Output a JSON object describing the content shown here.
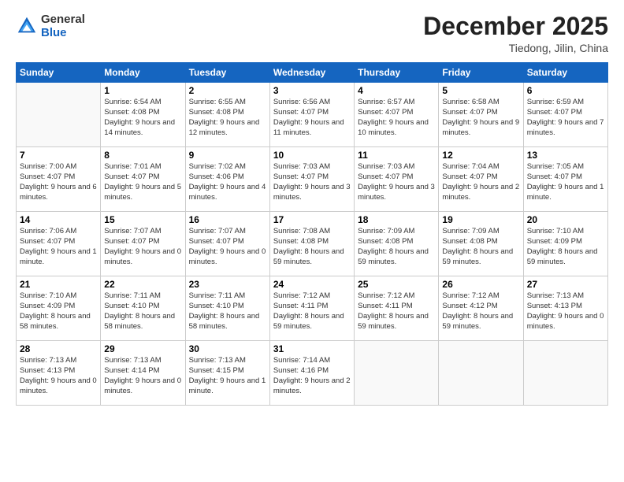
{
  "header": {
    "logo": {
      "general": "General",
      "blue": "Blue"
    },
    "title": "December 2025",
    "location": "Tiedong, Jilin, China"
  },
  "weekdays": [
    "Sunday",
    "Monday",
    "Tuesday",
    "Wednesday",
    "Thursday",
    "Friday",
    "Saturday"
  ],
  "weeks": [
    [
      {
        "day": null
      },
      {
        "day": "1",
        "rise": "Sunrise: 6:54 AM",
        "set": "Sunset: 4:08 PM",
        "daylight": "Daylight: 9 hours and 14 minutes."
      },
      {
        "day": "2",
        "rise": "Sunrise: 6:55 AM",
        "set": "Sunset: 4:08 PM",
        "daylight": "Daylight: 9 hours and 12 minutes."
      },
      {
        "day": "3",
        "rise": "Sunrise: 6:56 AM",
        "set": "Sunset: 4:07 PM",
        "daylight": "Daylight: 9 hours and 11 minutes."
      },
      {
        "day": "4",
        "rise": "Sunrise: 6:57 AM",
        "set": "Sunset: 4:07 PM",
        "daylight": "Daylight: 9 hours and 10 minutes."
      },
      {
        "day": "5",
        "rise": "Sunrise: 6:58 AM",
        "set": "Sunset: 4:07 PM",
        "daylight": "Daylight: 9 hours and 9 minutes."
      },
      {
        "day": "6",
        "rise": "Sunrise: 6:59 AM",
        "set": "Sunset: 4:07 PM",
        "daylight": "Daylight: 9 hours and 7 minutes."
      }
    ],
    [
      {
        "day": "7",
        "rise": "Sunrise: 7:00 AM",
        "set": "Sunset: 4:07 PM",
        "daylight": "Daylight: 9 hours and 6 minutes."
      },
      {
        "day": "8",
        "rise": "Sunrise: 7:01 AM",
        "set": "Sunset: 4:07 PM",
        "daylight": "Daylight: 9 hours and 5 minutes."
      },
      {
        "day": "9",
        "rise": "Sunrise: 7:02 AM",
        "set": "Sunset: 4:06 PM",
        "daylight": "Daylight: 9 hours and 4 minutes."
      },
      {
        "day": "10",
        "rise": "Sunrise: 7:03 AM",
        "set": "Sunset: 4:07 PM",
        "daylight": "Daylight: 9 hours and 3 minutes."
      },
      {
        "day": "11",
        "rise": "Sunrise: 7:03 AM",
        "set": "Sunset: 4:07 PM",
        "daylight": "Daylight: 9 hours and 3 minutes."
      },
      {
        "day": "12",
        "rise": "Sunrise: 7:04 AM",
        "set": "Sunset: 4:07 PM",
        "daylight": "Daylight: 9 hours and 2 minutes."
      },
      {
        "day": "13",
        "rise": "Sunrise: 7:05 AM",
        "set": "Sunset: 4:07 PM",
        "daylight": "Daylight: 9 hours and 1 minute."
      }
    ],
    [
      {
        "day": "14",
        "rise": "Sunrise: 7:06 AM",
        "set": "Sunset: 4:07 PM",
        "daylight": "Daylight: 9 hours and 1 minute."
      },
      {
        "day": "15",
        "rise": "Sunrise: 7:07 AM",
        "set": "Sunset: 4:07 PM",
        "daylight": "Daylight: 9 hours and 0 minutes."
      },
      {
        "day": "16",
        "rise": "Sunrise: 7:07 AM",
        "set": "Sunset: 4:07 PM",
        "daylight": "Daylight: 9 hours and 0 minutes."
      },
      {
        "day": "17",
        "rise": "Sunrise: 7:08 AM",
        "set": "Sunset: 4:08 PM",
        "daylight": "Daylight: 8 hours and 59 minutes."
      },
      {
        "day": "18",
        "rise": "Sunrise: 7:09 AM",
        "set": "Sunset: 4:08 PM",
        "daylight": "Daylight: 8 hours and 59 minutes."
      },
      {
        "day": "19",
        "rise": "Sunrise: 7:09 AM",
        "set": "Sunset: 4:08 PM",
        "daylight": "Daylight: 8 hours and 59 minutes."
      },
      {
        "day": "20",
        "rise": "Sunrise: 7:10 AM",
        "set": "Sunset: 4:09 PM",
        "daylight": "Daylight: 8 hours and 59 minutes."
      }
    ],
    [
      {
        "day": "21",
        "rise": "Sunrise: 7:10 AM",
        "set": "Sunset: 4:09 PM",
        "daylight": "Daylight: 8 hours and 58 minutes."
      },
      {
        "day": "22",
        "rise": "Sunrise: 7:11 AM",
        "set": "Sunset: 4:10 PM",
        "daylight": "Daylight: 8 hours and 58 minutes."
      },
      {
        "day": "23",
        "rise": "Sunrise: 7:11 AM",
        "set": "Sunset: 4:10 PM",
        "daylight": "Daylight: 8 hours and 58 minutes."
      },
      {
        "day": "24",
        "rise": "Sunrise: 7:12 AM",
        "set": "Sunset: 4:11 PM",
        "daylight": "Daylight: 8 hours and 59 minutes."
      },
      {
        "day": "25",
        "rise": "Sunrise: 7:12 AM",
        "set": "Sunset: 4:11 PM",
        "daylight": "Daylight: 8 hours and 59 minutes."
      },
      {
        "day": "26",
        "rise": "Sunrise: 7:12 AM",
        "set": "Sunset: 4:12 PM",
        "daylight": "Daylight: 8 hours and 59 minutes."
      },
      {
        "day": "27",
        "rise": "Sunrise: 7:13 AM",
        "set": "Sunset: 4:13 PM",
        "daylight": "Daylight: 9 hours and 0 minutes."
      }
    ],
    [
      {
        "day": "28",
        "rise": "Sunrise: 7:13 AM",
        "set": "Sunset: 4:13 PM",
        "daylight": "Daylight: 9 hours and 0 minutes."
      },
      {
        "day": "29",
        "rise": "Sunrise: 7:13 AM",
        "set": "Sunset: 4:14 PM",
        "daylight": "Daylight: 9 hours and 0 minutes."
      },
      {
        "day": "30",
        "rise": "Sunrise: 7:13 AM",
        "set": "Sunset: 4:15 PM",
        "daylight": "Daylight: 9 hours and 1 minute."
      },
      {
        "day": "31",
        "rise": "Sunrise: 7:14 AM",
        "set": "Sunset: 4:16 PM",
        "daylight": "Daylight: 9 hours and 2 minutes."
      },
      {
        "day": null
      },
      {
        "day": null
      },
      {
        "day": null
      }
    ]
  ]
}
